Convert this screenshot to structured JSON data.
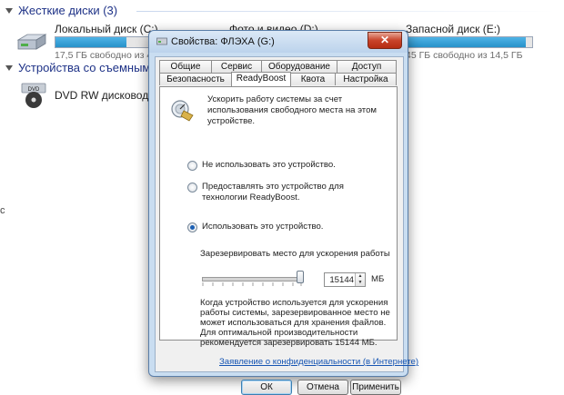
{
  "explorer": {
    "hard_disks_header": "Жесткие диски (3)",
    "removable_header": "Устройства со съемными н",
    "drives": [
      {
        "name": "Локальный диск (C:)",
        "free": "17,5 ГБ свободно из 43,9",
        "fill": 0.6
      },
      {
        "name": "Фото и видео (D:)",
        "free": "",
        "fill": 0.5
      },
      {
        "name": "Запасной диск (E:)",
        "free": "45 ГБ свободно из 14,5 ГБ",
        "fill": 0.95
      }
    ],
    "dvd": {
      "name": "DVD RW дисковод (F:)",
      "badge": "DVD"
    },
    "edge_char": "c"
  },
  "dialog": {
    "title": "Свойства: ФЛЭХА (G:)",
    "close_glyph": "✕",
    "tabs_row1": [
      "Общие",
      "Сервис",
      "Оборудование",
      "Доступ"
    ],
    "tabs_row2": [
      "Безопасность",
      "ReadyBoost",
      "Квота",
      "Настройка"
    ],
    "description": "Ускорить работу системы за счет использования свободного места на этом устройстве.",
    "options": [
      {
        "label": "Не использовать это устройство.",
        "checked": false
      },
      {
        "label": "Предоставлять это устройство для технологии ReadyBoost.",
        "checked": false
      },
      {
        "label": "Использовать это устройство.",
        "checked": true
      }
    ],
    "reserve_label": "Зарезервировать место для ускорения работы",
    "reserve_value": "15144",
    "reserve_unit": "МБ",
    "info_text": "Когда устройство используется для ускорения работы системы, зарезервированное место не может использоваться для хранения файлов.",
    "recommend_text": "Для оптимальной производительности рекомендуется зарезервировать 15144 МБ.",
    "privacy_link": "Заявление о конфиденциальности (в Интернете)",
    "buttons": {
      "ok": "ОК",
      "cancel": "Отмена",
      "apply": "Применить"
    }
  }
}
